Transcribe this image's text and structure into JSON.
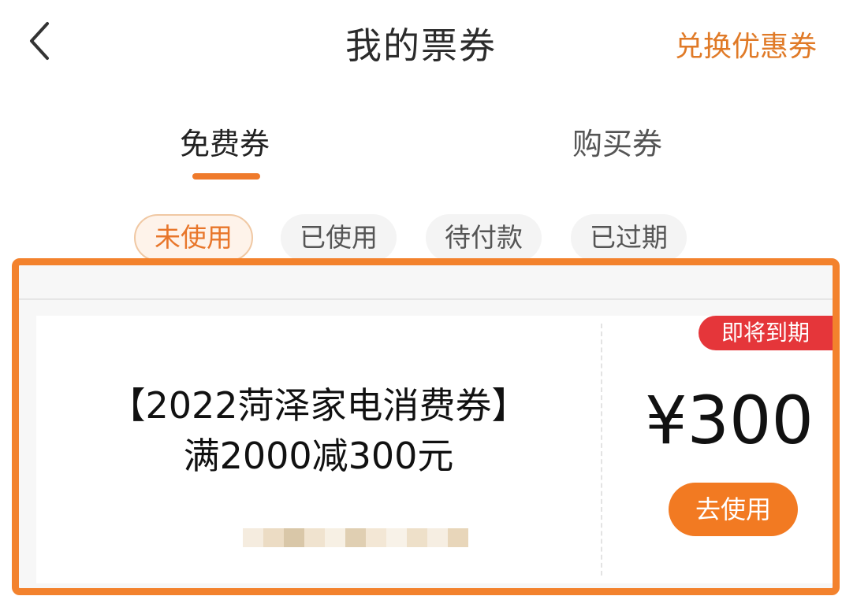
{
  "header": {
    "title": "我的票券",
    "action_link": "兑换优惠券",
    "back_icon": "chevron-left-icon"
  },
  "tabs": [
    {
      "label": "免费券",
      "active": true
    },
    {
      "label": "购买券",
      "active": false
    }
  ],
  "filters": [
    {
      "label": "未使用",
      "active": true
    },
    {
      "label": "已使用",
      "active": false
    },
    {
      "label": "待付款",
      "active": false
    },
    {
      "label": "已过期",
      "active": false
    }
  ],
  "coupon": {
    "title": "【2022菏泽家电消费券】",
    "subtitle": "满2000减300元",
    "badge": "即将到期",
    "amount": "¥300",
    "action_label": "去使用"
  },
  "colors": {
    "accent": "#f27a22",
    "highlight_frame": "#f3822d",
    "badge_red": "#e5363a"
  }
}
